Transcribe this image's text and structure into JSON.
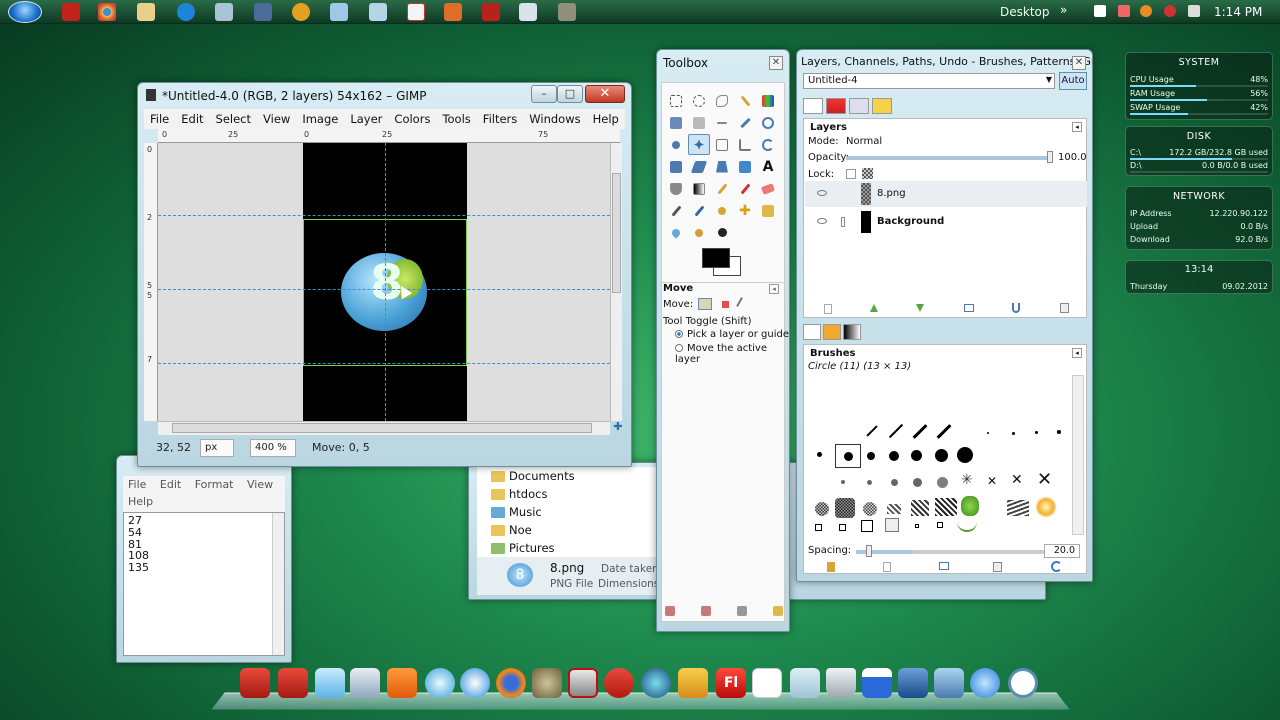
{
  "taskbar": {
    "desktop_label": "Desktop",
    "chevron": "»",
    "time": "1:14 PM",
    "icons": [
      "acrobat-icon",
      "chrome-icon",
      "folder-icon",
      "skype-icon",
      "app-icon",
      "app-icon",
      "yellow-app-icon",
      "app-icon",
      "app-icon",
      "paint-icon",
      "tools-icon",
      "red-app-icon",
      "app-icon",
      "gimp-icon"
    ]
  },
  "gimp_window": {
    "title": "*Untitled-4.0 (RGB, 2 layers) 54x162 – GIMP",
    "menus": [
      "File",
      "Edit",
      "Select",
      "View",
      "Image",
      "Layer",
      "Colors",
      "Tools",
      "Filters",
      "Windows",
      "Help"
    ],
    "ruler_h_ticks": [
      "0",
      "25",
      "0",
      "25",
      "75"
    ],
    "ruler_v_ticks": [
      "0",
      "2",
      "5",
      "5",
      "7"
    ],
    "status": {
      "coords": "32, 52",
      "unit": "px",
      "zoom": "400 %",
      "message": "Move: 0, 5"
    },
    "canvas_logo_text": "8"
  },
  "notepad": {
    "menus": [
      "File",
      "Edit",
      "Format",
      "View",
      "Help"
    ],
    "lines": [
      "27",
      "54",
      "81",
      "108",
      "135"
    ]
  },
  "explorer": {
    "folders": [
      "Documents",
      "htdocs",
      "Music",
      "Noe",
      "Pictures"
    ],
    "file": {
      "name": "8.png",
      "type": "PNG File",
      "date_label": "Date taken",
      "dims_label": "Dimensions",
      "icon_text": "8"
    }
  },
  "toolbox": {
    "title": "Toolbox",
    "tool_options_title": "Move",
    "move_label": "Move:",
    "toggle_label": "Tool Toggle  (Shift)",
    "option1": "Pick a layer or guide",
    "option2": "Move the active layer"
  },
  "dock": {
    "title": "Layers, Channels, Paths, Undo - Brushes, Patterns, Gra...",
    "image_selector": "Untitled-4",
    "auto_label": "Auto",
    "layers": {
      "title": "Layers",
      "mode_label": "Mode:",
      "mode_value": "Normal",
      "opacity_label": "Opacity:",
      "opacity_value": "100.0",
      "lock_label": "Lock:",
      "rows": [
        {
          "name": "8.png"
        },
        {
          "name": "Background"
        }
      ]
    },
    "brushes": {
      "title": "Brushes",
      "current": "Circle (11) (13 × 13)",
      "spacing_label": "Spacing:",
      "spacing_value": "20.0"
    }
  },
  "gadgets": {
    "system": {
      "title": "SYSTEM",
      "rows": [
        {
          "label": "CPU Usage",
          "value": "48%",
          "fraction": 0.48
        },
        {
          "label": "RAM Usage",
          "value": "56%",
          "fraction": 0.56
        },
        {
          "label": "SWAP Usage",
          "value": "42%",
          "fraction": 0.42
        }
      ]
    },
    "disk": {
      "title": "DISK",
      "rows": [
        {
          "label": "C:\\",
          "value": "172.2 GB/232.8 GB used",
          "fraction": 0.74
        },
        {
          "label": "D:\\",
          "value": "0.0 B/0.0 B used",
          "fraction": 0.0
        }
      ]
    },
    "network": {
      "title": "NETWORK",
      "rows": [
        {
          "label": "IP Address",
          "value": "12.220.90.122"
        },
        {
          "label": "Upload",
          "value": "0.0 B/s"
        },
        {
          "label": "Download",
          "value": "92.0 B/s"
        }
      ]
    },
    "clock": {
      "time": "13:14",
      "day": "Thursday",
      "date": "09.02.2012"
    }
  },
  "dock_apps": [
    "acrobat-icon",
    "acrobat-icon",
    "app-icon",
    "calculator-icon",
    "xampp-icon",
    "globe-icon",
    "safari-icon",
    "firefox-icon",
    "gimp-icon",
    "mcafee-icon",
    "app-icon",
    "app-icon",
    "app-icon",
    "flash-icon",
    "pdf-icon",
    "folder-icon",
    "trash-icon",
    "calendar-icon",
    "network-icon",
    "tools-icon",
    "app-icon",
    "clock-icon"
  ]
}
